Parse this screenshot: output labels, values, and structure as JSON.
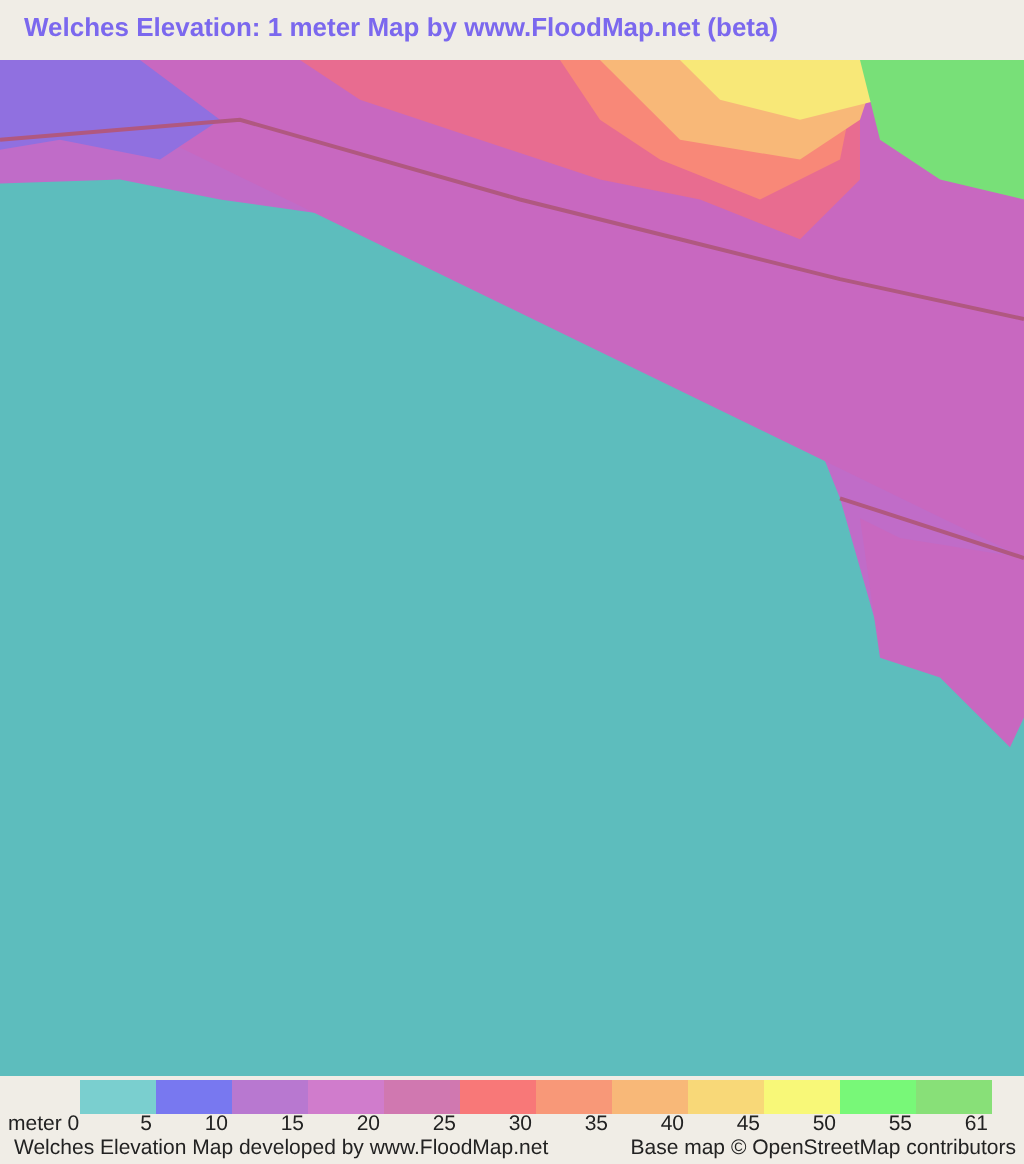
{
  "title": "Welches Elevation: 1 meter Map by www.FloodMap.net (beta)",
  "legend": {
    "unit_label": "meter 0",
    "swatches": [
      {
        "color": "#7acfcf",
        "label": "5"
      },
      {
        "color": "#7878f0",
        "label": "10"
      },
      {
        "color": "#b878d0",
        "label": "15"
      },
      {
        "color": "#d07ccc",
        "label": "20"
      },
      {
        "color": "#d078b0",
        "label": "25"
      },
      {
        "color": "#f87878",
        "label": "30"
      },
      {
        "color": "#f89878",
        "label": "35"
      },
      {
        "color": "#f8b878",
        "label": "40"
      },
      {
        "color": "#f8d878",
        "label": "45"
      },
      {
        "color": "#f8f878",
        "label": "50"
      },
      {
        "color": "#78f878",
        "label": "55"
      },
      {
        "color": "#88e078",
        "label": "61"
      }
    ]
  },
  "footer": {
    "credit": "Welches Elevation Map developed by www.FloodMap.net",
    "attribution": "Base map © OpenStreetMap contributors"
  }
}
